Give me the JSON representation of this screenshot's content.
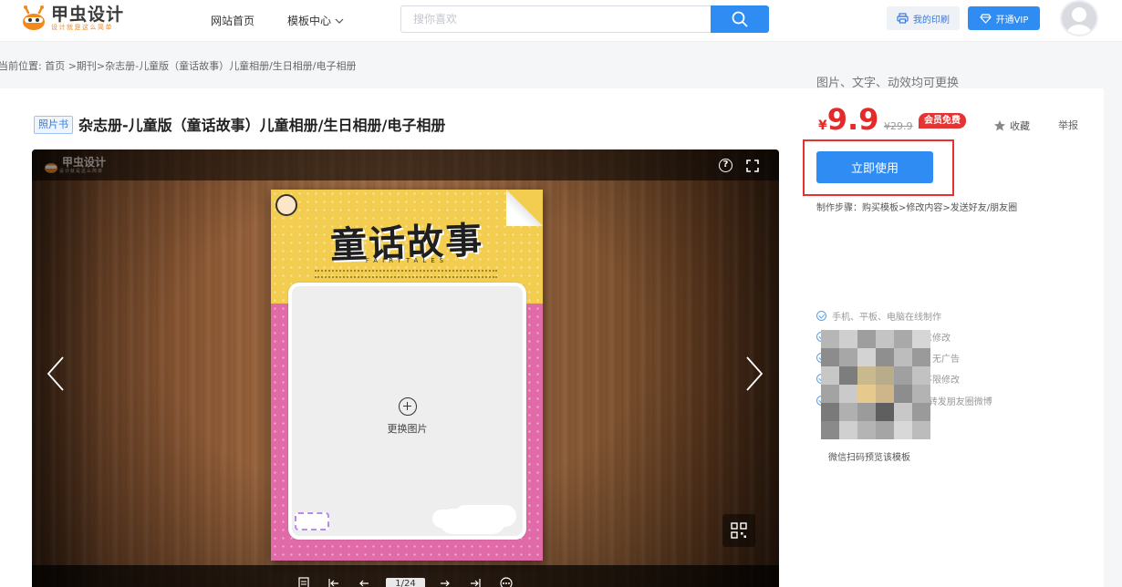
{
  "header": {
    "logo_title": "甲虫设计",
    "logo_slogan": "设计就是这么简单",
    "nav_home": "网站首页",
    "nav_templates": "模板中心",
    "search_placeholder": "搜你喜欢",
    "print_label": "我的印刷",
    "vip_label": "开通VIP"
  },
  "breadcrumb": "当前位置: 首页 >期刊>杂志册-儿童版（童话故事）儿童相册/生日相册/电子相册",
  "product": {
    "tag": "照片书",
    "title": "杂志册-儿童版（童话故事）儿童相册/生日相册/电子相册",
    "report": "举报"
  },
  "viewer": {
    "logo_title": "甲虫设计",
    "logo_slogan": "设计就是这么简单",
    "help": "?",
    "book_title": "童话故事",
    "book_subtitle": "FAIRYTALES",
    "replace_image": "更换图片",
    "page_indicator": "1/24"
  },
  "sidebar": {
    "description": "图片、文字、动效均可更换",
    "price_symbol": "¥",
    "price": "9.9",
    "original_price": "¥29.9",
    "member_free": "会员免费",
    "favorite": "收藏",
    "use_button": "立即使用",
    "steps": "制作步骤：购买模板>修改内容>发送好友/朋友圈",
    "features": [
      "手机、平板、电脑在线制作",
      "文字、图片、音乐、任意修改",
      "页面数量可增加、删除、无广告",
      "一次购买、永久有效、不限修改",
      "分享QQ微信好友，一键转发朋友圈微博"
    ],
    "qr_label": "微信扫码预览该模板"
  },
  "colors": {
    "brand_blue": "#2f8cf3",
    "price_red": "#e52a2a",
    "highlight_frame": "#e8312f",
    "logo_orange": "#f08a1c"
  }
}
